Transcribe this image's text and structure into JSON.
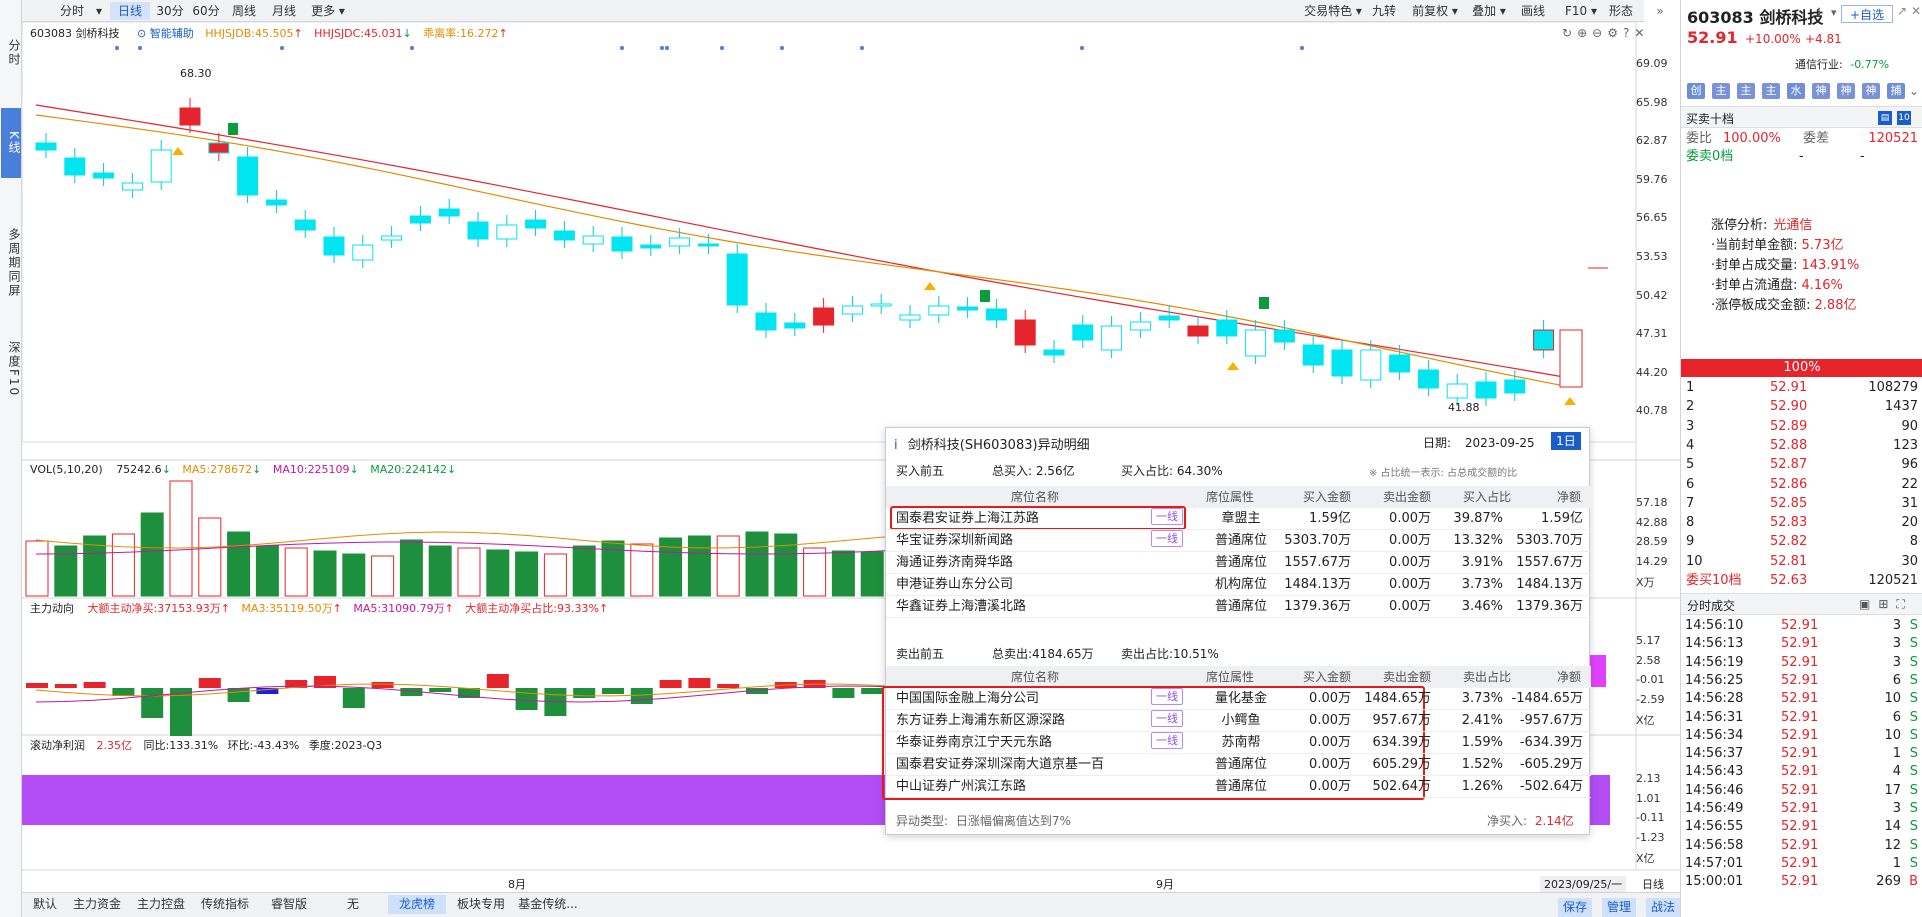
{
  "left_bar": {
    "items": [
      {
        "label": "分时",
        "active": false
      },
      {
        "label": "K线",
        "active": true
      },
      {
        "label": "多周期同屏",
        "active": false
      },
      {
        "label": "深度F10",
        "active": false
      }
    ]
  },
  "toolbar": {
    "left": [
      "分时",
      "日线",
      "30分",
      "60分",
      "周线",
      "月线",
      "更多"
    ],
    "active": "日线",
    "right": [
      "交易特色",
      "九转",
      "前复权",
      "叠加",
      "画线",
      "F10",
      "形态"
    ]
  },
  "kline_header": {
    "code": "603083 剑桥科技",
    "assist": "智能辅助",
    "ind1": "HHJSJDB:45.505",
    "ind2": "HHJSJDC:45.031",
    "ind3": "乖离率:16.272"
  },
  "price_axis": [
    "69.09",
    "65.98",
    "62.87",
    "59.76",
    "56.65",
    "53.53",
    "50.42",
    "47.31",
    "44.20",
    "40.78"
  ],
  "price_labels": {
    "high": "68.30",
    "low": "41.88"
  },
  "vol_header": {
    "name": "VOL(5,10,20)",
    "v": "75242.6",
    "ma5": "MA5:278672",
    "ma10": "MA10:225109",
    "ma20": "MA20:224142"
  },
  "vol_axis": [
    "57.18",
    "42.88",
    "28.59",
    "14.29",
    "X万"
  ],
  "flow_header": {
    "name": "主力动向",
    "a": "大额主动净买:37153.93万",
    "ma3": "MA3:35119.50万",
    "ma5": "MA5:31090.79万",
    "b": "大额主动净买占比:93.33%"
  },
  "flow_axis": [
    "5.17",
    "2.58",
    "-0.01",
    "-2.59",
    "X亿"
  ],
  "profit_header": {
    "name": "滚动净利润",
    "v": "2.35亿",
    "yoy": "同比:133.31%",
    "qoq": "环比:-43.43%",
    "season": "季度:2023-Q3"
  },
  "profit_axis": [
    "2.13",
    "1.01",
    "-0.11",
    "-1.23",
    "X亿"
  ],
  "date_axis": {
    "aug": "8月",
    "sep": "9月",
    "cursor": "2023/09/25/一",
    "period": "日线"
  },
  "bottom_tabs": [
    "默认",
    "主力资金",
    "主力控盘",
    "传统指标",
    "睿智版",
    "无",
    "龙虎榜",
    "板块专用",
    "基金传统..."
  ],
  "bottom_active": "龙虎榜",
  "bottom_right": [
    "保存",
    "管理",
    "战法"
  ],
  "quote": {
    "code_name": "603083 剑桥科技",
    "price": "52.91",
    "pct": "+10.00%",
    "chg": "+4.81",
    "industry_label": "通信行业:",
    "industry_pct": "-0.77%",
    "self_select": "+自选",
    "quick_icons": [
      "创",
      "主",
      "主",
      "主",
      "水",
      "神",
      "神",
      "神",
      "捕"
    ],
    "book_title": "买卖十档",
    "ratio_label": "委比",
    "ratio": "100.00%",
    "diff_label": "委差",
    "diff": "120521",
    "ask0": "委卖0档",
    "ask0_a": "-",
    "ask0_b": "-",
    "limit": {
      "title": "涨停分析:",
      "title_v": "光通信",
      "rows": [
        {
          "k": "·当前封单金额:",
          "v": "5.73亿"
        },
        {
          "k": "·封单占成交量:",
          "v": "143.91%"
        },
        {
          "k": "·封单占流通盘:",
          "v": "4.16%"
        },
        {
          "k": "·涨停板成交金额:",
          "v": "2.88亿"
        }
      ]
    },
    "bar_pct": "100%",
    "bids": [
      [
        "1",
        "52.91",
        "108279"
      ],
      [
        "2",
        "52.90",
        "1437"
      ],
      [
        "3",
        "52.89",
        "90"
      ],
      [
        "4",
        "52.88",
        "123"
      ],
      [
        "5",
        "52.87",
        "96"
      ],
      [
        "6",
        "52.86",
        "22"
      ],
      [
        "7",
        "52.85",
        "31"
      ],
      [
        "8",
        "52.83",
        "20"
      ],
      [
        "9",
        "52.82",
        "8"
      ],
      [
        "10",
        "52.81",
        "30"
      ]
    ],
    "bid10": {
      "label": "委买10档",
      "price": "52.63",
      "vol": "120521"
    },
    "ticks_title": "分时成交",
    "ticks": [
      [
        "14:56:10",
        "52.91",
        "3",
        "S"
      ],
      [
        "14:56:13",
        "52.91",
        "3",
        "S"
      ],
      [
        "14:56:19",
        "52.91",
        "3",
        "S"
      ],
      [
        "14:56:25",
        "52.91",
        "6",
        "S"
      ],
      [
        "14:56:28",
        "52.91",
        "10",
        "S"
      ],
      [
        "14:56:31",
        "52.91",
        "6",
        "S"
      ],
      [
        "14:56:34",
        "52.91",
        "10",
        "S"
      ],
      [
        "14:56:37",
        "52.91",
        "1",
        "S"
      ],
      [
        "14:56:43",
        "52.91",
        "4",
        "S"
      ],
      [
        "14:56:46",
        "52.91",
        "17",
        "S"
      ],
      [
        "14:56:49",
        "52.91",
        "3",
        "S"
      ],
      [
        "14:56:55",
        "52.91",
        "14",
        "S"
      ],
      [
        "14:56:58",
        "52.91",
        "12",
        "S"
      ],
      [
        "14:57:01",
        "52.91",
        "1",
        "S"
      ],
      [
        "15:00:01",
        "52.91",
        "269",
        "B"
      ]
    ]
  },
  "popup": {
    "title": "剑桥科技(SH603083)异动明细",
    "date_label": "日期:",
    "date": "2023-09-25",
    "period": "1日",
    "buy_title": "买入前五",
    "buy_total": "总买入: 2.56亿",
    "buy_ratio": "买入占比: 64.30%",
    "note": "※ 占比统一表示: 占总成交额的比",
    "cols": [
      "席位名称",
      "席位属性",
      "买入金额",
      "卖出金额",
      "买入占比",
      "净额"
    ],
    "cols_sell": [
      "席位名称",
      "席位属性",
      "买入金额",
      "卖出金额",
      "卖出占比",
      "净额"
    ],
    "buy_rows": [
      {
        "name": "国泰君安证券上海江苏路",
        "tag": "一线",
        "attr": "章盟主",
        "buy": "1.59亿",
        "sell": "0.00万",
        "ratio": "39.87%",
        "net": "1.59亿"
      },
      {
        "name": "华宝证券深圳新闻路",
        "tag": "一线",
        "attr": "普通席位",
        "buy": "5303.70万",
        "sell": "0.00万",
        "ratio": "13.32%",
        "net": "5303.70万"
      },
      {
        "name": "海通证券济南舜华路",
        "tag": "",
        "attr": "普通席位",
        "buy": "1557.67万",
        "sell": "0.00万",
        "ratio": "3.91%",
        "net": "1557.67万"
      },
      {
        "name": "申港证券山东分公司",
        "tag": "",
        "attr": "机构席位",
        "buy": "1484.13万",
        "sell": "0.00万",
        "ratio": "3.73%",
        "net": "1484.13万"
      },
      {
        "name": "华鑫证券上海漕溪北路",
        "tag": "",
        "attr": "普通席位",
        "buy": "1379.36万",
        "sell": "0.00万",
        "ratio": "3.46%",
        "net": "1379.36万"
      }
    ],
    "sell_title": "卖出前五",
    "sell_total": "总卖出:4184.65万",
    "sell_ratio": "卖出占比:10.51%",
    "sell_rows": [
      {
        "name": "中国国际金融上海分公司",
        "tag": "一线",
        "attr": "量化基金",
        "buy": "0.00万",
        "sell": "1484.65万",
        "ratio": "3.73%",
        "net": "-1484.65万"
      },
      {
        "name": "东方证券上海浦东新区源深路",
        "tag": "一线",
        "attr": "小鳄鱼",
        "buy": "0.00万",
        "sell": "957.67万",
        "ratio": "2.41%",
        "net": "-957.67万"
      },
      {
        "name": "华泰证券南京江宁天元东路",
        "tag": "一线",
        "attr": "苏南帮",
        "buy": "0.00万",
        "sell": "634.39万",
        "ratio": "1.59%",
        "net": "-634.39万"
      },
      {
        "name": "国泰君安证券深圳深南大道京基一百",
        "tag": "",
        "attr": "普通席位",
        "buy": "0.00万",
        "sell": "605.29万",
        "ratio": "1.52%",
        "net": "-605.29万"
      },
      {
        "name": "中山证券广州滨江东路",
        "tag": "",
        "attr": "普通席位",
        "buy": "0.00万",
        "sell": "502.64万",
        "ratio": "1.26%",
        "net": "-502.64万"
      }
    ],
    "type_label": "异动类型:",
    "type": "日涨幅偏离值达到7%",
    "net_label": "净买入:",
    "net": "2.14亿"
  },
  "colors": {
    "up": "#e5242b",
    "down": "#0a9c3d",
    "kdown": "#00e5f0",
    "accent": "#1a5dc9",
    "purple": "#b34cf5"
  }
}
